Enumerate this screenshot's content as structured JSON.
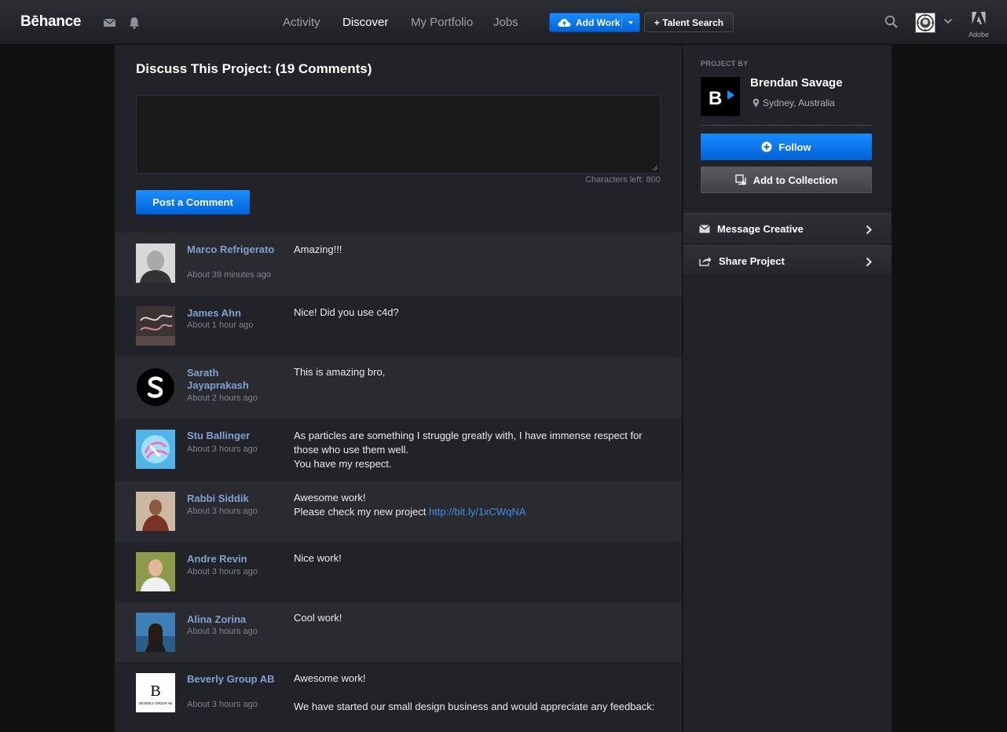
{
  "nav": {
    "logo": "Bēhance",
    "links": [
      {
        "label": "Activity",
        "active": false
      },
      {
        "label": "Discover",
        "active": true
      },
      {
        "label": "My Portfolio",
        "active": false
      },
      {
        "label": "Jobs",
        "active": false
      }
    ],
    "add_work_label": "Add Work",
    "talent_search_label": "+ Talent Search",
    "adobe_label": "Adobe"
  },
  "discussion": {
    "title": "Discuss This Project: (19 Comments)",
    "chars_left": "Characters left: 800",
    "post_label": "Post a Comment"
  },
  "comments": [
    {
      "name": "Marco Refrigerato",
      "time": "About 39 minutes ago",
      "text": "Amazing!!!"
    },
    {
      "name": "James Ahn",
      "time": "About 1 hour ago",
      "text": "Nice! Did you use c4d?"
    },
    {
      "name": "Sarath Jayaprakash",
      "time": "About 2 hours ago",
      "text": "This is amazing bro,"
    },
    {
      "name": "Stu Ballinger",
      "time": "About 3 hours ago",
      "text": "As particles are something I struggle greatly with, I have immense respect for those who use them well.",
      "text2": "You have my respect."
    },
    {
      "name": "Rabbi Siddik",
      "time": "About 3 hours ago",
      "text": "Awesome work!",
      "text2": "Please check my new project ",
      "link": "http://bit.ly/1xCWqNA"
    },
    {
      "name": "Andre Revin",
      "time": "About 3 hours ago",
      "text": "Nice work!"
    },
    {
      "name": "Alina Zorina",
      "time": "About 3 hours ago",
      "text": "Cool work!"
    },
    {
      "name": "Beverly Group AB",
      "time": "About 3 hours ago",
      "text": "Awesome work!",
      "text2": "We have started our small design business and would appreciate any feedback:"
    }
  ],
  "sidebar": {
    "project_by": "PROJECT BY",
    "owner_name": "Brendan Savage",
    "owner_location": "Sydney, Australia",
    "follow_label": "Follow",
    "collection_label": "Add to Collection",
    "message_label": "Message Creative",
    "share_label": "Share Project",
    "beverly_logo_text": "BEVERLY GROUP AB"
  },
  "colors": {
    "accent": "#0b74f0",
    "name_link": "#7fa1cf",
    "url_link": "#3d8fe6"
  }
}
